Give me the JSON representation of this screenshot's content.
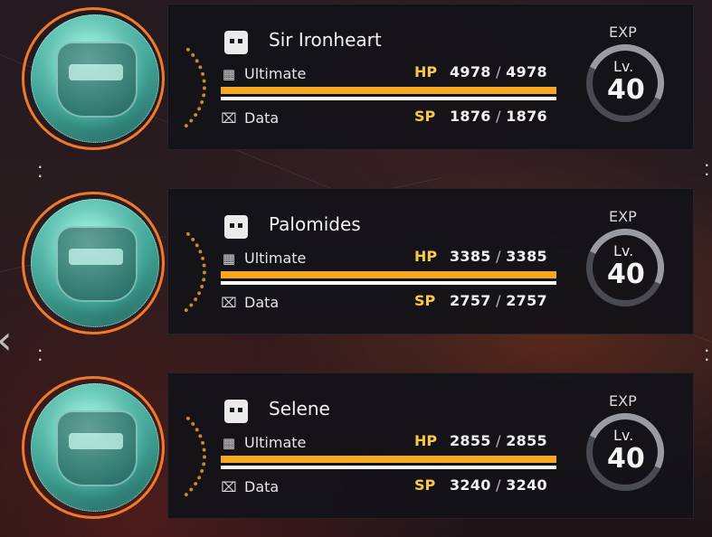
{
  "nav": {
    "back_icon": "chevron-left-icon"
  },
  "party": [
    {
      "name": "Sir Ironheart",
      "class_icon": "robot-head-icon",
      "ultimate_label": "Ultimate",
      "data_label": "Data",
      "hp_label": "HP",
      "hp_current": "4978",
      "hp_max": "4978",
      "hp_fraction": 1.0,
      "sp_label": "SP",
      "sp_current": "1876",
      "sp_max": "1876",
      "sp_fraction": 1.0,
      "exp_label": "EXP",
      "level_label": "Lv.",
      "level": "40"
    },
    {
      "name": "Palomides",
      "class_icon": "robot-head-icon",
      "ultimate_label": "Ultimate",
      "data_label": "Data",
      "hp_label": "HP",
      "hp_current": "3385",
      "hp_max": "3385",
      "hp_fraction": 1.0,
      "sp_label": "SP",
      "sp_current": "2757",
      "sp_max": "2757",
      "sp_fraction": 1.0,
      "exp_label": "EXP",
      "level_label": "Lv.",
      "level": "40"
    },
    {
      "name": "Selene",
      "class_icon": "robot-head-icon",
      "ultimate_label": "Ultimate",
      "data_label": "Data",
      "hp_label": "HP",
      "hp_current": "2855",
      "hp_max": "2855",
      "hp_fraction": 1.0,
      "sp_label": "SP",
      "sp_current": "3240",
      "sp_max": "3240",
      "sp_fraction": 1.0,
      "exp_label": "EXP",
      "level_label": "Lv.",
      "level": "40"
    }
  ],
  "colors": {
    "hp_bar": "#f5a623",
    "sp_bar": "#ffffff",
    "stat_key": "#f7c843",
    "portrait_ring": "#f07a2c"
  }
}
